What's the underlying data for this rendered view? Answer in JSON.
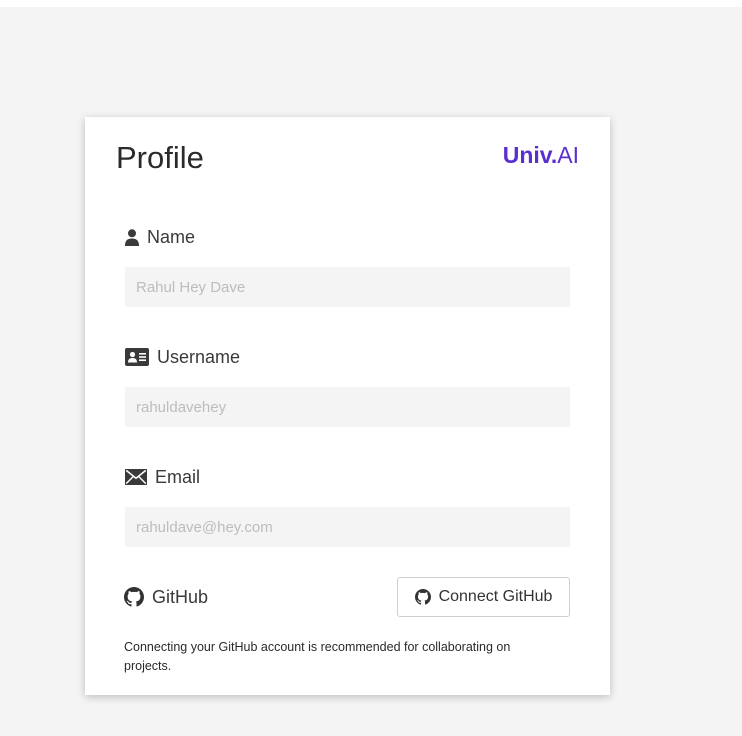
{
  "profile": {
    "title": "Profile",
    "brand": {
      "strong": "Univ.",
      "light": "AI",
      "color": "#5a2fd0"
    },
    "fields": {
      "name": {
        "label": "Name",
        "placeholder": "Rahul Hey Dave",
        "value": "",
        "icon": "person-icon"
      },
      "username": {
        "label": "Username",
        "placeholder": "rahuldavehey",
        "value": "",
        "icon": "id-card-icon"
      },
      "email": {
        "label": "Email",
        "placeholder": "rahuldave@hey.com",
        "value": "",
        "icon": "envelope-icon"
      }
    },
    "github": {
      "label": "GitHub",
      "icon": "github-icon",
      "connect_button_label": "Connect GitHub",
      "help_text": "Connecting your GitHub account is recommended for collaborating on projects."
    }
  }
}
